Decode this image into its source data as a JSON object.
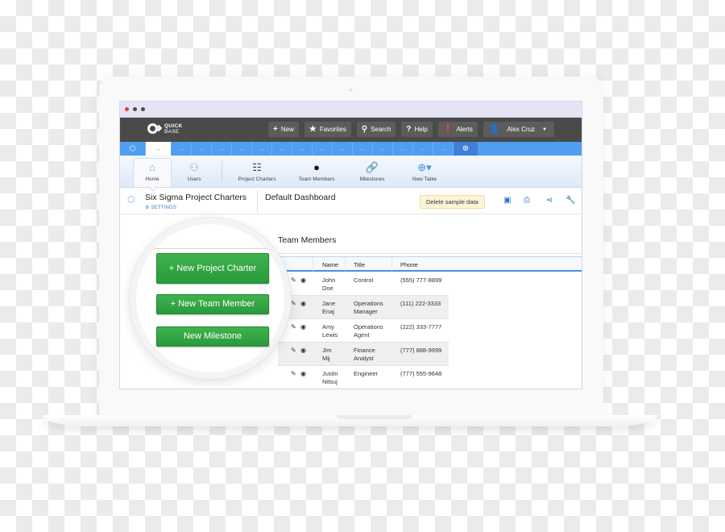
{
  "window": {
    "dots": [
      {
        "name": "close",
        "color": "#e0443e"
      },
      {
        "name": "minimize",
        "color": "#4a4a4a"
      },
      {
        "name": "maximize",
        "color": "#4a4a4a"
      }
    ]
  },
  "brand": {
    "line1": "QUICK",
    "line2": "BASE"
  },
  "topnav": {
    "new": "New",
    "favorites": "Favorites",
    "search": "Search",
    "help": "Help",
    "alerts": "Alerts",
    "user": "Alex Cruz"
  },
  "tabs": {
    "active_label": "...",
    "labels": [
      "...",
      "...",
      "...",
      "...",
      "...",
      "...",
      "...",
      "...",
      "...",
      "...",
      "...",
      "...",
      "...",
      "..."
    ]
  },
  "iconbar": {
    "items": [
      {
        "label": "Home",
        "icon": "home-icon"
      },
      {
        "label": "Users",
        "icon": "user-icon"
      },
      {
        "label": "Project Charters",
        "icon": "checklist-icon"
      },
      {
        "label": "Team Members",
        "icon": "person-icon"
      },
      {
        "label": "Milestones",
        "icon": "link-icon"
      },
      {
        "label": "New Table",
        "icon": "plus-circle-icon"
      }
    ]
  },
  "pagehead": {
    "app_title": "Six Sigma Project Charters",
    "settings": "SETTINGS",
    "dashboard_title": "Default Dashboard",
    "delete_sample": "Delete sample data"
  },
  "buttons": {
    "new_project_charter": "+ New Project Charter",
    "new_team_member": "+ New Team Member",
    "new_milestone": "New Milestone"
  },
  "team_members": {
    "title": "Team Members",
    "columns": [
      "Name",
      "Title",
      "Phone"
    ],
    "rows": [
      {
        "name1": "John",
        "name2": "Doe",
        "title1": "Control",
        "title2": "",
        "phone": "(555) 777-8899"
      },
      {
        "name1": "Jane",
        "name2": "Enaj",
        "title1": "Operations",
        "title2": "Manager",
        "phone": "(111) 222-3333"
      },
      {
        "name1": "Amy",
        "name2": "Lewis",
        "title1": "Operations",
        "title2": "Agent",
        "phone": "(222) 333-7777"
      },
      {
        "name1": "Jim",
        "name2": "Mij",
        "title1": "Finance",
        "title2": "Analyst",
        "phone": "(777) 888-9999"
      },
      {
        "name1": "Justin",
        "name2": "Nitsuj",
        "title1": "Engineer",
        "title2": "",
        "phone": "(777) 555-9648"
      }
    ]
  },
  "colors": {
    "topbar": "#4a4a4a",
    "tabstrip": "#4f9ff0",
    "accent_green": "#2fa33f",
    "link_blue": "#3d78d0"
  }
}
